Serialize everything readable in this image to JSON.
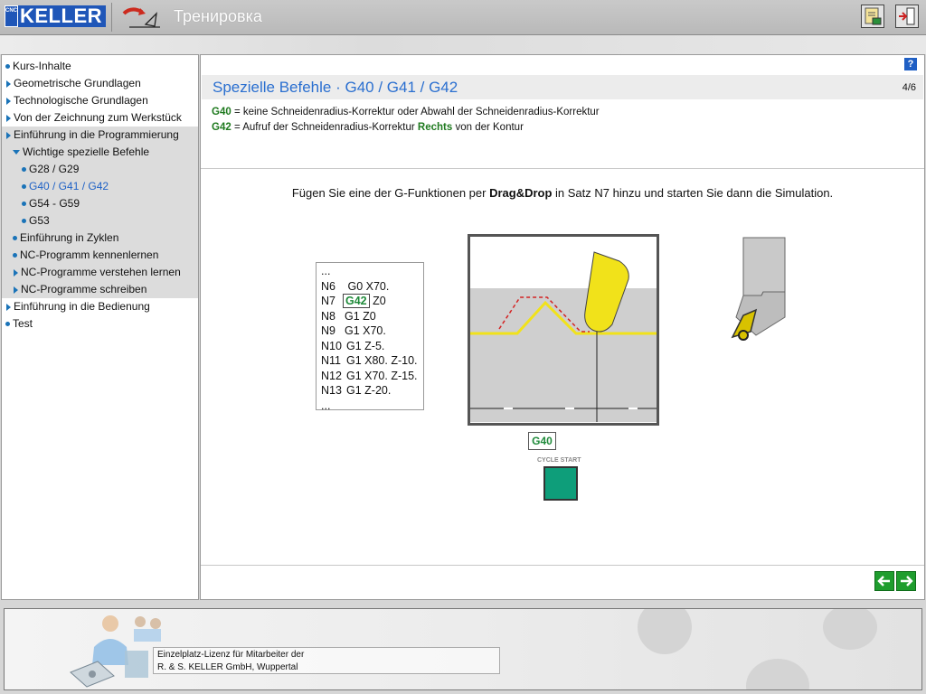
{
  "header": {
    "logo_small": "CNC",
    "logo_text": "KELLER",
    "title": "Тренировка"
  },
  "sidebar": {
    "items": [
      {
        "label": "Kurs-Inhalte"
      },
      {
        "label": "Geometrische Grundlagen"
      },
      {
        "label": "Technologische Grundlagen"
      },
      {
        "label": "Von der Zeichnung zum Werkstück"
      },
      {
        "label": "Einführung in die Programmierung"
      },
      {
        "label": "Wichtige spezielle Befehle"
      },
      {
        "label": "G28 / G29"
      },
      {
        "label": "G40 / G41 / G42"
      },
      {
        "label": "G54 - G59"
      },
      {
        "label": "G53"
      },
      {
        "label": "Einführung in Zyklen"
      },
      {
        "label": "NC-Programm kennenlernen"
      },
      {
        "label": "NC-Programme verstehen lernen"
      },
      {
        "label": "NC-Programme schreiben"
      },
      {
        "label": "Einführung in die Bedienung"
      },
      {
        "label": "Test"
      }
    ]
  },
  "content": {
    "help": "?",
    "title": "Spezielle Befehle · G40 / G41 / G42",
    "page": "4/6",
    "def1": {
      "code": "G40",
      "text": " = keine  Schneidenradius-Korrektur oder Abwahl der  Schneidenradius-Korrektur"
    },
    "def2": {
      "code": "G42",
      "text_a": " = Aufruf der Schneidenradius-Korrektur ",
      "bold": "Rechts",
      "text_b": " von der Kontur"
    },
    "instruction": {
      "a": "Fügen Sie eine der G-Funktionen per ",
      "bold": "Drag&Drop",
      "b": " in Satz N7 hinzu und starten Sie dann die Simulation."
    },
    "code": {
      "first": "...",
      "n6": {
        "n": "N6",
        "t": " G0 X70."
      },
      "n7": {
        "n": "N7",
        "chip": "G42",
        "t": " Z0"
      },
      "lines": [
        {
          "n": "N8",
          "t": "G1 Z0"
        },
        {
          "n": "N9",
          "t": "G1 X70."
        },
        {
          "n": "N10",
          "t": "G1 Z-5."
        },
        {
          "n": "N11",
          "t": "G1 X80. Z-10."
        },
        {
          "n": "N12",
          "t": "G1 X70. Z-15."
        },
        {
          "n": "N13",
          "t": "G1 Z-20."
        }
      ],
      "last": "..."
    },
    "draggable": "G40",
    "cycle_label": "CYCLE START"
  },
  "footer": {
    "line1": "Einzelplatz-Lizenz für Mitarbeiter der",
    "line2": "R. & S. KELLER GmbH, Wuppertal"
  },
  "colors": {
    "accent": "#2a6fd0",
    "g_code": "#1f8a3a",
    "cycle": "#0e9e7a",
    "nav_arrow": "#1f9d2e"
  }
}
